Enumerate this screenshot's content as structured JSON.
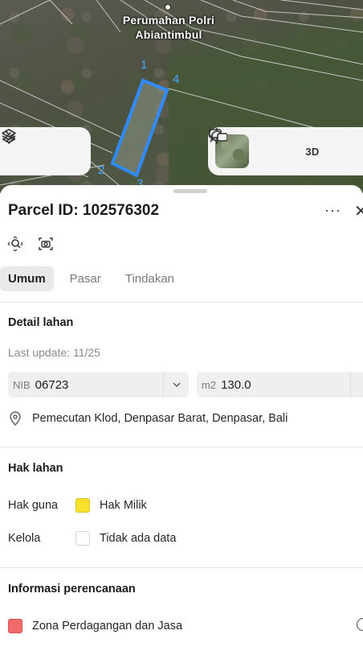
{
  "map": {
    "place_label_line1": "Perumahan Polri",
    "place_label_line2": "Abiantimbul",
    "corner_numbers": [
      "1",
      "4",
      "2",
      "3"
    ],
    "parcel_outline_color": "#2f8bff",
    "controls_left": {
      "layers_icon": "layers-icon",
      "draw_icon": "draw-icon"
    },
    "controls_right": {
      "basemap_icon": "satellite-thumbnail",
      "locate_icon": "crosshair-icon",
      "three_d_label": "3D",
      "comment_icon": "message-icon"
    }
  },
  "sheet": {
    "title": "Parcel ID: 102576302",
    "more_label": "···",
    "close_label": "✕",
    "tools": [
      "zoom-to-parcel-icon",
      "camera-icon"
    ]
  },
  "tabs": [
    {
      "label": "Umum",
      "active": true
    },
    {
      "label": "Pasar",
      "active": false
    },
    {
      "label": "Tindakan",
      "active": false
    }
  ],
  "detail": {
    "heading": "Detail lahan",
    "last_update": "Last update: 11/25",
    "nib_prefix": "NIB",
    "nib_value": "06723",
    "area_prefix": "m2",
    "area_value": "130.0",
    "address": "Pemecutan Klod, Denpasar Barat, Denpasar, Bali"
  },
  "rights": {
    "heading": "Hak lahan",
    "rows": [
      {
        "label": "Hak guna",
        "value": "Hak Milik",
        "color": "#f9e02c"
      },
      {
        "label": "Kelola",
        "value": "Tidak ada data",
        "color": "#ffffff"
      }
    ]
  },
  "planning": {
    "heading": "Informasi perencanaan",
    "zone": "Zona Perdagangan dan Jasa",
    "zone_color": "#f06a6a"
  }
}
